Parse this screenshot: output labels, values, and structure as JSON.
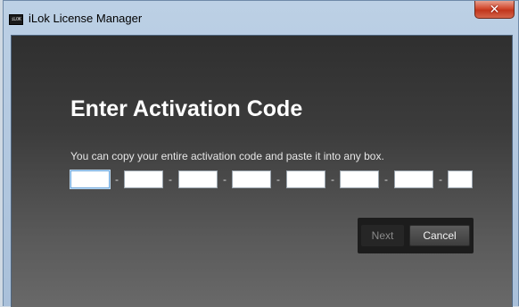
{
  "window": {
    "title": "iLok License Manager",
    "app_icon_text": "iLOK",
    "close_glyph": "✕"
  },
  "dialog": {
    "heading": "Enter Activation Code",
    "hint": "You can copy your entire activation code and paste it into any box.",
    "separator": "-",
    "code_boxes": [
      "",
      "",
      "",
      "",
      "",
      "",
      "",
      ""
    ],
    "next_label": "Next",
    "cancel_label": "Cancel"
  },
  "colors": {
    "content_bg_top": "#2f2f2f",
    "content_bg_bottom": "#696969",
    "close_button": "#c1361d"
  }
}
